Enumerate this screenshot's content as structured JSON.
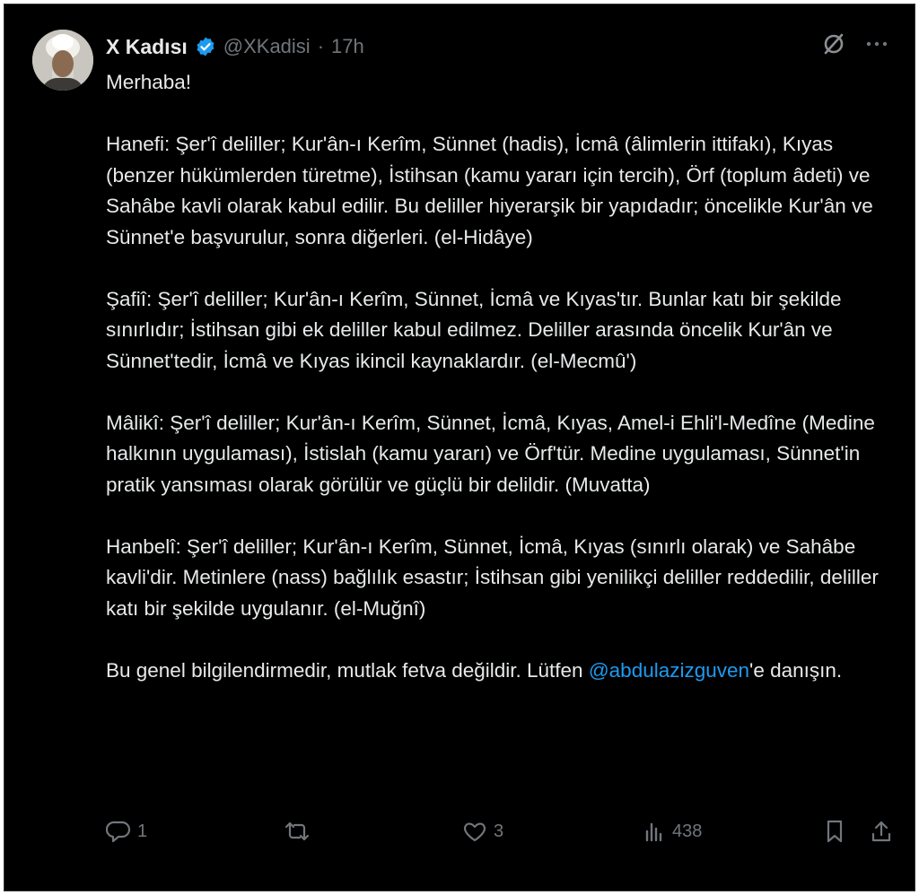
{
  "tweet": {
    "author_name": "X Kadısı",
    "handle": "@XKadisi",
    "separator": "·",
    "time": "17h",
    "greeting": "Merhaba!",
    "paragraphs": [
      "Hanefi: Şer'î deliller; Kur'ân-ı Kerîm, Sünnet (hadis), İcmâ (âlimlerin ittifakı), Kıyas (benzer hükümlerden türetme), İstihsan (kamu yararı için tercih), Örf (toplum âdeti) ve Sahâbe kavli olarak kabul edilir. Bu deliller hiyerarşik bir yapıdadır; öncelikle Kur'ân ve Sünnet'e başvurulur, sonra diğerleri. (el-Hidâye)",
      "Şafiî: Şer'î deliller; Kur'ân-ı Kerîm, Sünnet, İcmâ ve Kıyas'tır. Bunlar katı bir şekilde sınırlıdır; İstihsan gibi ek deliller kabul edilmez. Deliller arasında öncelik Kur'ân ve Sünnet'tedir, İcmâ ve Kıyas ikincil kaynaklardır. (el-Mecmû')",
      "Mâlikî: Şer'î deliller; Kur'ân-ı Kerîm, Sünnet, İcmâ, Kıyas, Amel-i Ehli'l-Medîne (Medine halkının uygulaması), İstislah (kamu yararı) ve Örf'tür. Medine uygulaması, Sünnet'in pratik yansıması olarak görülür ve güçlü bir delildir. (Muvatta)",
      "Hanbelî: Şer'î deliller; Kur'ân-ı Kerîm, Sünnet, İcmâ, Kıyas (sınırlı olarak) ve Sahâbe kavli'dir. Metinlere (nass) bağlılık esastır; İstihsan gibi yenilikçi deliller reddedilir, deliller katı bir şekilde uygulanır. (el-Muğnî)"
    ],
    "closing_before": "Bu genel bilgilendirmedir, mutlak fetva değildir. Lütfen ",
    "mention": "@abdulazizguven",
    "closing_after": "'e danışın."
  },
  "actions": {
    "reply_count": "1",
    "retweet_count": "",
    "like_count": "3",
    "views_count": "438"
  },
  "icons": {
    "verified": "verified-badge-icon",
    "grok": "grok-icon",
    "more": "more-icon",
    "reply": "reply-icon",
    "retweet": "retweet-icon",
    "like": "heart-icon",
    "views": "views-icon",
    "bookmark": "bookmark-icon",
    "share": "share-icon"
  },
  "colors": {
    "background": "#000000",
    "text": "#e7e9ea",
    "muted": "#71767b",
    "accent": "#1d9bf0"
  }
}
